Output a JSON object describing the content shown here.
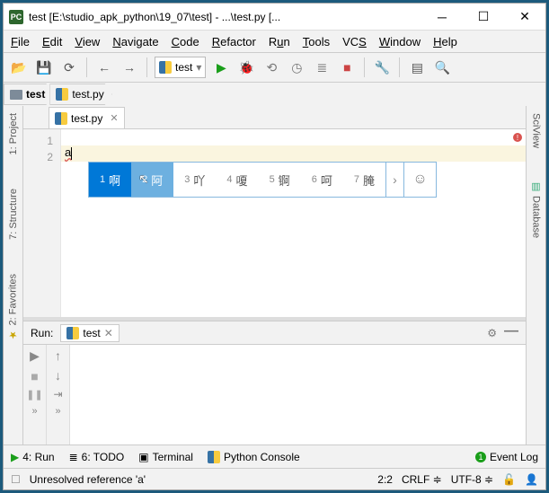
{
  "window": {
    "title": "test [E:\\studio_apk_python\\19_07\\test] - ...\\test.py [..."
  },
  "menu": [
    "File",
    "Edit",
    "View",
    "Navigate",
    "Code",
    "Refactor",
    "Run",
    "Tools",
    "VCS",
    "Window",
    "Help"
  ],
  "run_config": {
    "label": "test"
  },
  "breadcrumbs": [
    {
      "kind": "folder",
      "label": "test"
    },
    {
      "kind": "py",
      "label": "test.py"
    }
  ],
  "editor_tab": {
    "label": "test.py"
  },
  "code": {
    "line1": "",
    "line2_text": "a",
    "line_numbers": [
      "1",
      "2"
    ]
  },
  "ime": {
    "candidates": [
      {
        "n": "1",
        "ch": "啊"
      },
      {
        "n": "2",
        "ch": "阿"
      },
      {
        "n": "3",
        "ch": "吖"
      },
      {
        "n": "4",
        "ch": "嗄"
      },
      {
        "n": "5",
        "ch": "锕"
      },
      {
        "n": "6",
        "ch": "呵"
      },
      {
        "n": "7",
        "ch": "腌"
      }
    ],
    "emoji": "☺"
  },
  "left_tabs": [
    {
      "label": "1: Project"
    },
    {
      "label": "7: Structure"
    },
    {
      "label": "2: Favorites"
    }
  ],
  "right_tabs": [
    {
      "label": "SciView"
    },
    {
      "label": "Database"
    }
  ],
  "run_panel": {
    "title": "Run:",
    "tab": "test"
  },
  "bottom_tabs": {
    "run": "4: Run",
    "todo": "6: TODO",
    "terminal": "Terminal",
    "pyconsole": "Python Console",
    "eventlog": "Event Log"
  },
  "status": {
    "message": "Unresolved reference 'a'",
    "pos": "2:2",
    "eol": "CRLF",
    "enc": "UTF-8"
  }
}
